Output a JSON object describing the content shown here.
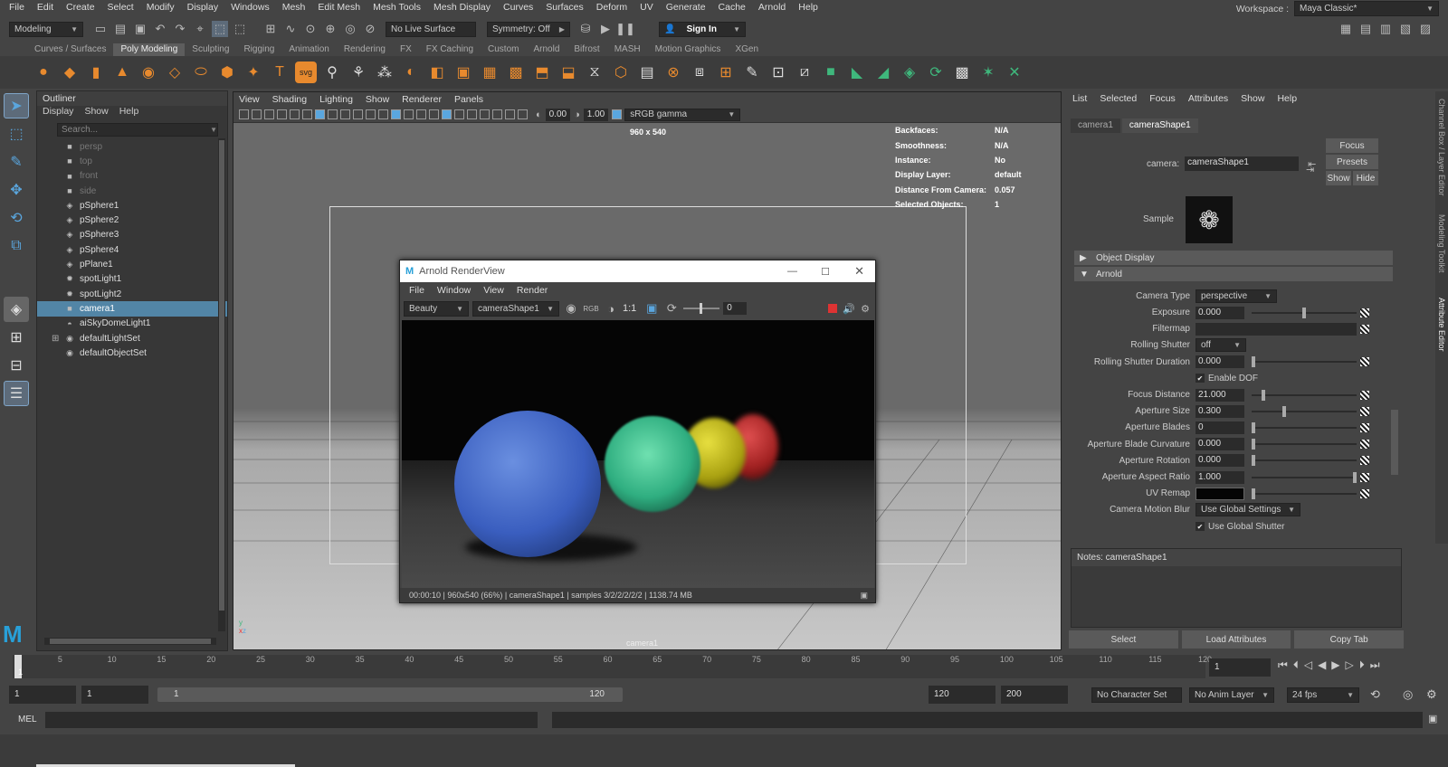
{
  "menubar": [
    "File",
    "Edit",
    "Create",
    "Select",
    "Modify",
    "Display",
    "Windows",
    "Mesh",
    "Edit Mesh",
    "Mesh Tools",
    "Mesh Display",
    "Curves",
    "Surfaces",
    "Deform",
    "UV",
    "Generate",
    "Cache",
    "Arnold",
    "Help"
  ],
  "workspace": {
    "label": "Workspace :",
    "value": "Maya Classic*"
  },
  "status": {
    "mode": "Modeling",
    "live": "No Live Surface",
    "symmetry": "Symmetry: Off",
    "signin": "Sign In"
  },
  "shelf_tabs": [
    "Curves / Surfaces",
    "Poly Modeling",
    "Sculpting",
    "Rigging",
    "Animation",
    "Rendering",
    "FX",
    "FX Caching",
    "Custom",
    "Arnold",
    "Bifrost",
    "MASH",
    "Motion Graphics",
    "XGen"
  ],
  "shelf_active": "Poly Modeling",
  "outliner": {
    "title": "Outliner",
    "menu": [
      "Display",
      "Show",
      "Help"
    ],
    "search": "Search...",
    "items": [
      {
        "label": "persp",
        "icon": "camera-icon",
        "dim": true
      },
      {
        "label": "top",
        "icon": "camera-icon",
        "dim": true
      },
      {
        "label": "front",
        "icon": "camera-icon",
        "dim": true
      },
      {
        "label": "side",
        "icon": "camera-icon",
        "dim": true
      },
      {
        "label": "pSphere1",
        "icon": "mesh-icon"
      },
      {
        "label": "pSphere2",
        "icon": "mesh-icon"
      },
      {
        "label": "pSphere3",
        "icon": "mesh-icon"
      },
      {
        "label": "pSphere4",
        "icon": "mesh-icon"
      },
      {
        "label": "pPlane1",
        "icon": "mesh-icon"
      },
      {
        "label": "spotLight1",
        "icon": "spotlight-icon"
      },
      {
        "label": "spotLight2",
        "icon": "spotlight-icon"
      },
      {
        "label": "camera1",
        "icon": "camera-icon",
        "selected": true
      },
      {
        "label": "aiSkyDomeLight1",
        "icon": "skydome-icon"
      },
      {
        "label": "defaultLightSet",
        "icon": "set-icon",
        "expand": true
      },
      {
        "label": "defaultObjectSet",
        "icon": "set-icon"
      }
    ]
  },
  "viewport": {
    "menu": [
      "View",
      "Shading",
      "Lighting",
      "Show",
      "Renderer",
      "Panels"
    ],
    "exposure": "0.00",
    "gamma": "1.00",
    "colorspace": "sRGB gamma",
    "resolution": "960 x 540",
    "camera_label": "camera1",
    "hud": [
      {
        "k": "Backfaces:",
        "v": "N/A"
      },
      {
        "k": "Smoothness:",
        "v": "N/A"
      },
      {
        "k": "Instance:",
        "v": "No"
      },
      {
        "k": "Display Layer:",
        "v": "default"
      },
      {
        "k": "Distance From Camera:",
        "v": "0.057"
      },
      {
        "k": "Selected Objects:",
        "v": "1"
      }
    ]
  },
  "renderview": {
    "title": "Arnold RenderView",
    "menu": [
      "File",
      "Window",
      "View",
      "Render"
    ],
    "aov": "Beauty",
    "camera": "cameraShape1",
    "ratio": "1:1",
    "frame": "0",
    "status": "00:00:10 | 960x540 (66%) | cameraShape1  | samples 3/2/2/2/2/2 | 1138.74 MB"
  },
  "attr_editor": {
    "menu": [
      "List",
      "Selected",
      "Focus",
      "Attributes",
      "Show",
      "Help"
    ],
    "tabs": [
      "camera1",
      "cameraShape1"
    ],
    "camera_label": "camera:",
    "camera_value": "cameraShape1",
    "buttons": {
      "focus": "Focus",
      "presets": "Presets",
      "show": "Show",
      "hide": "Hide"
    },
    "sample_label": "Sample",
    "sections": {
      "object_display": "Object Display",
      "arnold": "Arnold"
    },
    "camera_type": {
      "label": "Camera Type",
      "value": "perspective"
    },
    "attrs": [
      {
        "label": "Exposure",
        "value": "0.000",
        "slider": 0.5
      },
      {
        "label": "Filtermap",
        "value": "",
        "wide": true
      },
      {
        "label": "Rolling Shutter",
        "value": "off",
        "dropdown": true
      },
      {
        "label": "Rolling Shutter Duration",
        "value": "0.000",
        "slider": 0
      },
      {
        "check": "Enable DOF"
      },
      {
        "label": "Focus Distance",
        "value": "21.000",
        "slider": 0.1
      },
      {
        "label": "Aperture Size",
        "value": "0.300",
        "slider": 0.3
      },
      {
        "label": "Aperture Blades",
        "value": "0",
        "slider": 0
      },
      {
        "label": "Aperture Blade Curvature",
        "value": "0.000",
        "slider": 0
      },
      {
        "label": "Aperture Rotation",
        "value": "0.000",
        "slider": 0
      },
      {
        "label": "Aperture Aspect Ratio",
        "value": "1.000",
        "slider": 1
      },
      {
        "label": "UV Remap",
        "value": "",
        "color": "#050505",
        "slider": 0
      },
      {
        "label": "Camera Motion Blur",
        "value": "Use Global Settings",
        "dropdown": true
      },
      {
        "check": "Use Global Shutter"
      }
    ],
    "notes": "Notes:  cameraShape1",
    "bottom": [
      "Select",
      "Load Attributes",
      "Copy Tab"
    ]
  },
  "sidetabs": [
    "Channel Box / Layer Editor",
    "Modeling Toolkit",
    "Attribute Editor"
  ],
  "timeline": {
    "ticks": [
      "1",
      "5",
      "10",
      "15",
      "20",
      "25",
      "30",
      "35",
      "40",
      "45",
      "50",
      "55",
      "60",
      "65",
      "70",
      "75",
      "80",
      "85",
      "90",
      "95",
      "100",
      "105",
      "110",
      "115",
      "120"
    ],
    "current": "1"
  },
  "range": {
    "start": "1",
    "start2": "1",
    "slider_start": "1",
    "slider_end": "120",
    "end": "120",
    "end2": "200",
    "charset": "No Character Set",
    "animlayer": "No Anim Layer",
    "fps": "24 fps"
  },
  "cmdline": {
    "label": "MEL"
  },
  "colors": {
    "accent": "#5285a6",
    "orange": "#e88a2e",
    "green": "#3fb77c"
  }
}
